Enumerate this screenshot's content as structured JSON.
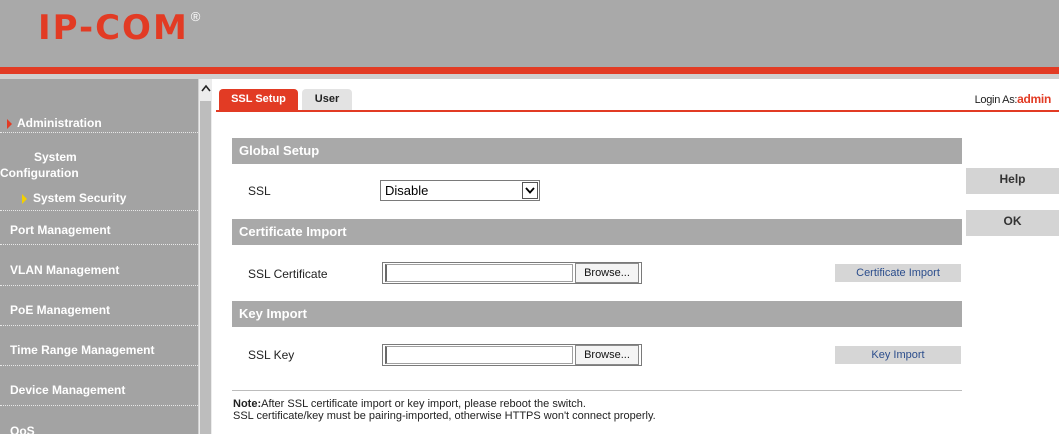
{
  "header": {
    "logo_text": "IP-COM",
    "logo_mark": "®",
    "brand_color": "#e23b24"
  },
  "sidebar": {
    "items": [
      {
        "label": "Administration"
      },
      {
        "label": "System Configuration"
      },
      {
        "label": "System Security"
      },
      {
        "label": "Port Management"
      },
      {
        "label": "VLAN Management"
      },
      {
        "label": "PoE Management"
      },
      {
        "label": "Time Range Management"
      },
      {
        "label": "Device Management"
      },
      {
        "label": "QoS"
      }
    ]
  },
  "tabs": [
    {
      "label": "SSL Setup",
      "active": true
    },
    {
      "label": "User",
      "active": false
    }
  ],
  "login": {
    "prefix": "Login As:",
    "user": "admin"
  },
  "sections": {
    "global": {
      "title": "Global Setup",
      "ssl_label": "SSL",
      "ssl_value": "Disable"
    },
    "cert": {
      "title": "Certificate Import",
      "field_label": "SSL Certificate",
      "browse_label": "Browse...",
      "button_label": "Certificate Import"
    },
    "key": {
      "title": "Key Import",
      "field_label": "SSL Key",
      "browse_label": "Browse...",
      "button_label": "Key Import"
    }
  },
  "note": {
    "prefix": "Note:",
    "line1": "After SSL certificate import or key import, please reboot the switch.",
    "line2": "SSL certificate/key must be pairing-imported, otherwise HTTPS won't connect properly."
  },
  "right_buttons": {
    "help": "Help",
    "ok": "OK"
  },
  "icons": {
    "scroll_up": "chevron-up-icon",
    "dropdown": "chevron-down-icon",
    "active_menu": "triangle-right-icon"
  }
}
